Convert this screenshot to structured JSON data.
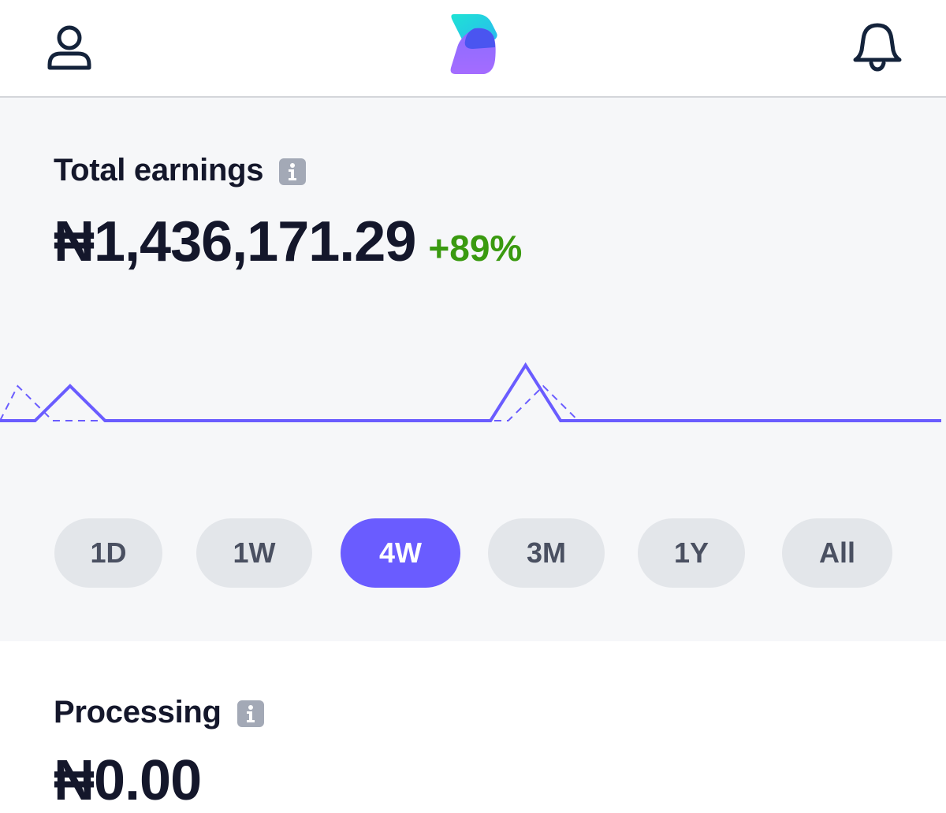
{
  "header": {
    "profile_icon": "user-icon",
    "logo_icon": "app-logo",
    "notifications_icon": "bell-icon"
  },
  "earnings": {
    "title": "Total earnings",
    "info_icon": "info-icon",
    "amount": "₦1,436,171.29",
    "change": "+89%",
    "change_color": "#3a9a10"
  },
  "chart_data": {
    "type": "line",
    "series": [
      {
        "style": "solid",
        "color": "#6a5cff",
        "values": [
          0,
          0,
          1,
          0,
          0,
          0,
          0,
          0,
          0,
          0,
          0,
          0,
          0,
          0,
          0,
          1.6,
          0,
          0,
          0,
          0,
          0,
          0,
          0,
          0,
          0,
          0,
          0,
          0
        ]
      },
      {
        "style": "dashed",
        "color": "#6a5cff",
        "values": [
          0,
          1,
          0,
          0,
          0,
          0,
          0,
          0,
          0,
          0,
          0,
          0,
          0,
          0,
          0,
          0,
          1,
          0,
          0,
          0,
          0,
          0,
          0,
          0,
          0,
          0,
          0,
          0
        ]
      }
    ],
    "grid": false,
    "axes": false
  },
  "ranges": {
    "options": [
      "1D",
      "1W",
      "4W",
      "3M",
      "1Y",
      "All"
    ],
    "selected": "4W",
    "accent": "#6a5cff"
  },
  "processing": {
    "title": "Processing",
    "info_icon": "info-icon",
    "amount": "₦0.00"
  }
}
